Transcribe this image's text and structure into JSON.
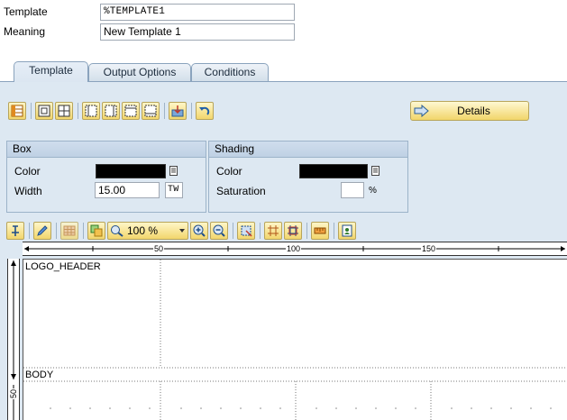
{
  "header": {
    "template_label": "Template",
    "template_value": "%TEMPLATE1",
    "meaning_label": "Meaning",
    "meaning_value": "New Template 1"
  },
  "tabs": [
    {
      "label": "Template",
      "active": true
    },
    {
      "label": "Output Options",
      "active": false
    },
    {
      "label": "Conditions",
      "active": false
    }
  ],
  "toolbar1": {
    "buttons": [
      "table-icon",
      "insert-row-icon",
      "split-cell-icon",
      "merge-left-icon",
      "merge-right-icon",
      "merge-up-icon",
      "merge-down-icon",
      "import-icon",
      "undo-icon"
    ],
    "details_label": "Details"
  },
  "box": {
    "title": "Box",
    "color_label": "Color",
    "color_value": "#000000",
    "width_label": "Width",
    "width_value": "15.00",
    "unit": "TW"
  },
  "shading": {
    "title": "Shading",
    "color_label": "Color",
    "color_value": "#000000",
    "saturation_label": "Saturation",
    "saturation_value": "",
    "percent": "%"
  },
  "toolbar2": {
    "zoom_value": "100 %"
  },
  "ruler": {
    "h_labels": [
      "50",
      "100",
      "150"
    ],
    "v_labels": [
      "50"
    ]
  },
  "canvas": {
    "windows": [
      "LOGO_HEADER",
      "BODY"
    ]
  }
}
